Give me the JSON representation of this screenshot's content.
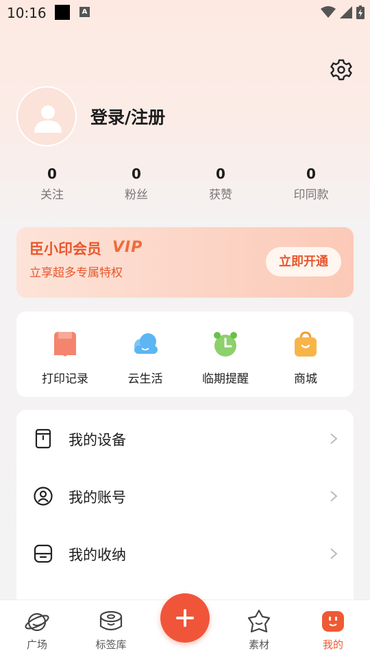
{
  "status_bar": {
    "time": "10:16",
    "notification_letter": "A"
  },
  "profile": {
    "login_text": "登录/注册"
  },
  "stats": [
    {
      "value": "0",
      "label": "关注"
    },
    {
      "value": "0",
      "label": "粉丝"
    },
    {
      "value": "0",
      "label": "获赞"
    },
    {
      "value": "0",
      "label": "印同款"
    }
  ],
  "vip": {
    "title": "臣小印会员",
    "badge": "VIP",
    "subtitle": "立享超多专属特权",
    "button": "立即开通"
  },
  "tools": [
    {
      "label": "打印记录",
      "icon": "print-record-icon",
      "color": "#f4846e"
    },
    {
      "label": "云生活",
      "icon": "cloud-icon",
      "color": "#5bb6f3"
    },
    {
      "label": "临期提醒",
      "icon": "alarm-clock-icon",
      "color": "#8ed06c"
    },
    {
      "label": "商城",
      "icon": "shopping-bag-icon",
      "color": "#f7b548"
    }
  ],
  "menu": [
    {
      "label": "我的设备",
      "icon": "device-icon"
    },
    {
      "label": "我的账号",
      "icon": "account-icon"
    },
    {
      "label": "我的收纳",
      "icon": "storage-icon"
    }
  ],
  "tabbar": [
    {
      "label": "广场",
      "icon": "planet-icon",
      "active": false
    },
    {
      "label": "标签库",
      "icon": "label-tape-icon",
      "active": false
    },
    {
      "label": "",
      "icon": "plus-icon",
      "active": false
    },
    {
      "label": "素材",
      "icon": "star-face-icon",
      "active": false
    },
    {
      "label": "我的",
      "icon": "me-face-icon",
      "active": true
    }
  ],
  "colors": {
    "accent": "#ef5a33",
    "vip_text": "#e7572d"
  }
}
